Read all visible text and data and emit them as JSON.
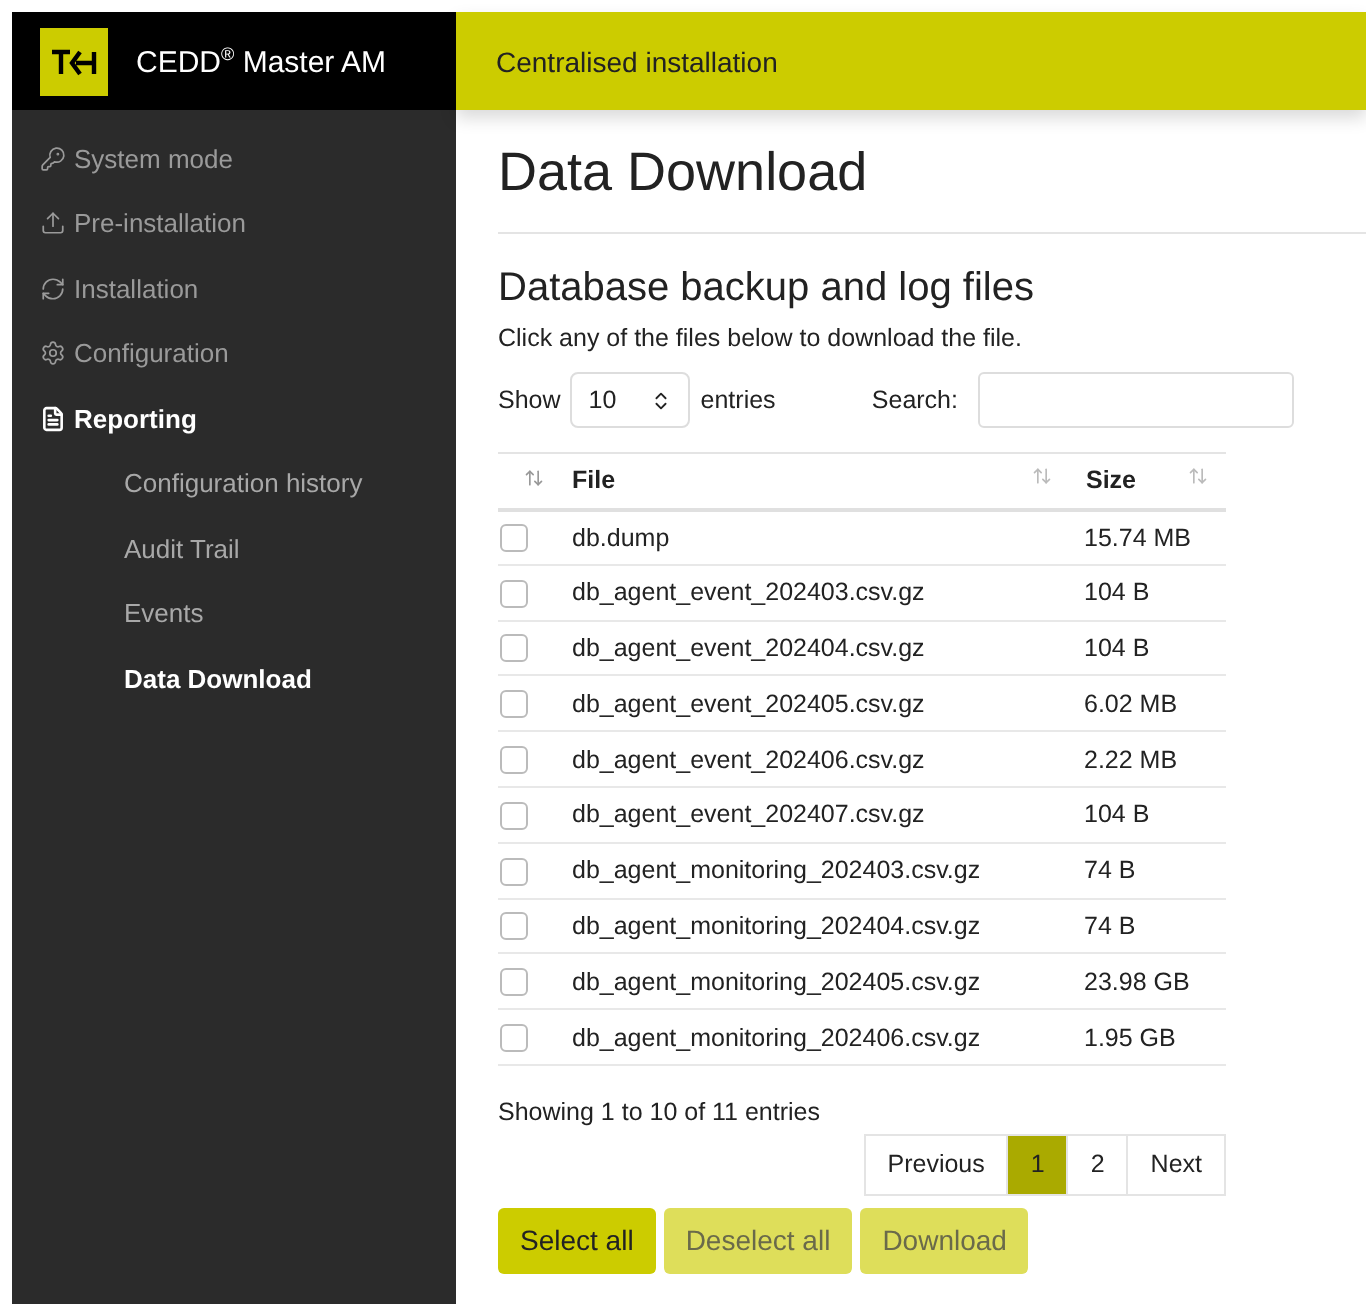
{
  "brand": {
    "name": "CEDD$^{®}$ Master AM"
  },
  "header": {
    "title": "Centralised installation"
  },
  "sidebar": {
    "items": [
      {
        "label": "System mode",
        "kind": "key",
        "selected": false
      },
      {
        "label": "Pre-installation",
        "kind": "upload",
        "selected": false
      },
      {
        "label": "Installation",
        "kind": "refresh",
        "selected": false
      },
      {
        "label": "Configuration",
        "kind": "gear",
        "selected": false
      },
      {
        "label": "Reporting",
        "kind": "file",
        "selected": true,
        "children": [
          {
            "label": "Configuration history",
            "selected": false
          },
          {
            "label": "Audit Trail",
            "selected": false
          },
          {
            "label": "Events",
            "selected": false
          },
          {
            "label": "Data Download",
            "selected": true
          }
        ]
      }
    ]
  },
  "page_title": "Data Download",
  "section": {
    "title": "Database backup and log files",
    "description": "Click any of the files below to download the file."
  },
  "length_control": {
    "label_before": "Show",
    "value": "10",
    "label_after": "entries"
  },
  "search": {
    "label": "Search:"
  },
  "table": {
    "columns": [
      "File",
      "Size"
    ],
    "rows": [
      {
        "file": "db.dump",
        "size": "15.74 MB",
        "checked": false
      },
      {
        "file": "db_agent_event_202403.csv.gz",
        "size": "104 B",
        "checked": false
      },
      {
        "file": "db_agent_event_202404.csv.gz",
        "size": "104 B",
        "checked": false
      },
      {
        "file": "db_agent_event_202405.csv.gz",
        "size": "6.02 MB",
        "checked": false
      },
      {
        "file": "db_agent_event_202406.csv.gz",
        "size": "2.22 MB",
        "checked": false
      },
      {
        "file": "db_agent_event_202407.csv.gz",
        "size": "104 B",
        "checked": false
      },
      {
        "file": "db_agent_monitoring_202403.csv.gz",
        "size": "74 B",
        "checked": false
      },
      {
        "file": "db_agent_monitoring_202404.csv.gz",
        "size": "74 B",
        "checked": false
      },
      {
        "file": "db_agent_monitoring_202405.csv.gz",
        "size": "23.98 GB",
        "checked": false
      },
      {
        "file": "db_agent_monitoring_202406.csv.gz",
        "size": "1.95 GB",
        "checked": false
      }
    ]
  },
  "info": "Showing 1 to 10 of 11 entries",
  "pagination": {
    "previous": "Previous",
    "pages": [
      {
        "label": "1",
        "selected": true
      },
      {
        "label": "2",
        "selected": false
      }
    ],
    "next": "Next"
  },
  "buttons": [
    {
      "label": "Select all",
      "disabled": false
    },
    {
      "label": "Deselect all",
      "disabled": true
    },
    {
      "label": "Download",
      "disabled": true
    }
  ]
}
